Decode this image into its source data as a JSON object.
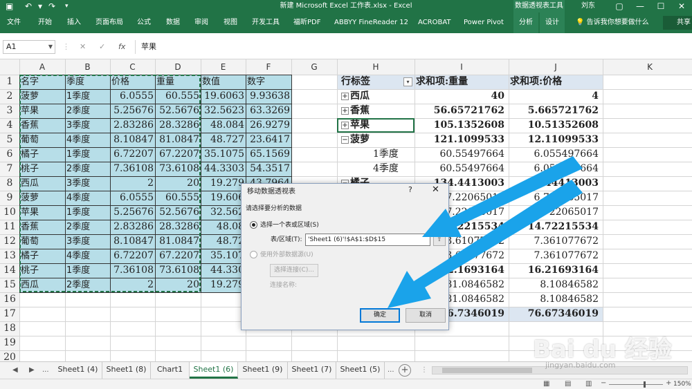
{
  "app": {
    "window_title": "新建 Microsoft Excel 工作表.xlsx  -  Excel",
    "context_label": "数据透视表工具",
    "user": "刘东",
    "window_controls": {
      "restore": "▢",
      "minimize": "—",
      "maximize": "☐",
      "close": "✕"
    }
  },
  "ribbon": {
    "tabs": [
      "文件",
      "开始",
      "插入",
      "页面布局",
      "公式",
      "数据",
      "审阅",
      "视图",
      "开发工具",
      "福昕PDF",
      "ABBYY FineReader 12",
      "ACROBAT",
      "Power Pivot",
      "分析",
      "设计"
    ],
    "tell_me": "告诉我你想要做什么",
    "share": "共享"
  },
  "formula_bar": {
    "name_box": "A1",
    "cancel": "✕",
    "enter": "✓",
    "fx": "fx",
    "value": "苹果"
  },
  "columns": [
    "A",
    "B",
    "C",
    "D",
    "E",
    "F",
    "G",
    "H",
    "I",
    "J",
    "K"
  ],
  "rows": [
    "1",
    "2",
    "3",
    "4",
    "5",
    "6",
    "7",
    "8",
    "9",
    "10",
    "11",
    "12",
    "13",
    "14",
    "15",
    "16",
    "17",
    "18",
    "19",
    "20"
  ],
  "source_table": {
    "headers": [
      "名字",
      "季度",
      "价格",
      "重量",
      "数值",
      "数字"
    ],
    "rows": [
      [
        "菠萝",
        "1季度",
        "6.0555",
        "60.555",
        "19.6063",
        "9.93638"
      ],
      [
        "苹果",
        "2季度",
        "5.25676",
        "52.5676",
        "32.5623",
        "63.3269"
      ],
      [
        "香蕉",
        "3季度",
        "2.83286",
        "28.3286",
        "48.084",
        "26.9279"
      ],
      [
        "葡萄",
        "4季度",
        "8.10847",
        "81.0847",
        "48.727",
        "23.6417"
      ],
      [
        "橘子",
        "1季度",
        "6.72207",
        "67.2207",
        "35.1075",
        "65.1569"
      ],
      [
        "桃子",
        "2季度",
        "7.36108",
        "73.6108",
        "44.3303",
        "54.3517"
      ],
      [
        "西瓜",
        "3季度",
        "2",
        "20",
        "19.279",
        "43.7964"
      ],
      [
        "菠萝",
        "4季度",
        "6.0555",
        "60.555",
        "19.606",
        ""
      ],
      [
        "苹果",
        "1季度",
        "5.25676",
        "52.5676",
        "32.562",
        ""
      ],
      [
        "香蕉",
        "2季度",
        "2.83286",
        "28.3286",
        "48.08",
        ""
      ],
      [
        "葡萄",
        "3季度",
        "8.10847",
        "81.0847",
        "48.72",
        ""
      ],
      [
        "橘子",
        "4季度",
        "6.72207",
        "67.2207",
        "35.107",
        ""
      ],
      [
        "桃子",
        "1季度",
        "7.36108",
        "73.6108",
        "44.330",
        ""
      ],
      [
        "西瓜",
        "2季度",
        "2",
        "20",
        "19.279",
        ""
      ]
    ]
  },
  "pivot": {
    "headers": [
      "行标签",
      "求和项:重量",
      "求和项:价格"
    ],
    "filter_icon": "▾",
    "rows": [
      {
        "label": "西瓜",
        "v1": "40",
        "v2": "4",
        "indent": 0,
        "toggle": "+",
        "bold": true
      },
      {
        "label": "香蕉",
        "v1": "56.65721762",
        "v2": "5.665721762",
        "indent": 0,
        "toggle": "+",
        "bold": true
      },
      {
        "label": "苹果",
        "v1": "105.1352608",
        "v2": "10.51352608",
        "indent": 0,
        "toggle": "+",
        "bold": true
      },
      {
        "label": "菠萝",
        "v1": "121.1099533",
        "v2": "12.11099533",
        "indent": 0,
        "toggle": "−",
        "bold": true
      },
      {
        "label": "1季度",
        "v1": "60.55497664",
        "v2": "6.055497664",
        "indent": 1,
        "toggle": "",
        "bold": false
      },
      {
        "label": "4季度",
        "v1": "60.55497664",
        "v2": "6.055497664",
        "indent": 1,
        "toggle": "",
        "bold": false
      },
      {
        "label": "橘子",
        "v1": "134.4413003",
        "v2": "13.44413003",
        "indent": 0,
        "toggle": "−",
        "bold": true
      },
      {
        "label": "",
        "v1": "67.22065017",
        "v2": "6.722065017",
        "indent": 1,
        "toggle": "",
        "bold": false
      },
      {
        "label": "",
        "v1": "67.22065017",
        "v2": "6.722065017",
        "indent": 1,
        "toggle": "",
        "bold": false
      },
      {
        "label": "",
        "v1": "147.2215534",
        "v2": "14.72215534",
        "indent": 0,
        "toggle": "",
        "bold": true
      },
      {
        "label": "",
        "v1": "73.61077672",
        "v2": "7.361077672",
        "indent": 1,
        "toggle": "",
        "bold": false
      },
      {
        "label": "",
        "v1": "73.61077672",
        "v2": "7.361077672",
        "indent": 1,
        "toggle": "",
        "bold": false
      },
      {
        "label": "",
        "v1": "162.1693164",
        "v2": "16.21693164",
        "indent": 0,
        "toggle": "",
        "bold": true
      },
      {
        "label": "",
        "v1": "81.0846582",
        "v2": "8.10846582",
        "indent": 1,
        "toggle": "",
        "bold": false
      },
      {
        "label": "",
        "v1": "81.0846582",
        "v2": "8.10846582",
        "indent": 1,
        "toggle": "",
        "bold": false
      },
      {
        "label": "",
        "v1": "766.7346019",
        "v2": "76.67346019",
        "indent": 0,
        "toggle": "",
        "bold": true
      }
    ]
  },
  "dialog": {
    "title": "移动数据透视表",
    "help": "?",
    "close": "✕",
    "prompt": "请选择要分析的数据",
    "option_range": "选择一个表或区域(S)",
    "range_label": "表/区域(T):",
    "range_value": "'Sheet1 (6)'!$A$1:$D$15",
    "range_picker": "⇧",
    "option_external": "使用外部数据源(U)",
    "choose_connection": "选择连接(C)...",
    "connection_name": "连接名称:",
    "ok": "确定",
    "cancel": "取消"
  },
  "sheet_tabs": {
    "nav": [
      "◀",
      "▶",
      "..."
    ],
    "tabs": [
      "Sheet1 (4)",
      "Sheet1 (8)",
      "Chart1",
      "Sheet1 (6)",
      "Sheet1 (9)",
      "Sheet1 (7)",
      "Sheet1 (5)"
    ],
    "active": "Sheet1 (6)",
    "more": "...",
    "add": "+"
  },
  "status": {
    "zoom": "150%"
  },
  "watermark": {
    "text": "Bai du 经验",
    "url": "jingyan.baidu.com"
  },
  "colors": {
    "excel_green": "#217346",
    "source_fill": "#b7dee8",
    "pivot_header_fill": "#dce6f1",
    "arrow": "#1aa3ea"
  }
}
